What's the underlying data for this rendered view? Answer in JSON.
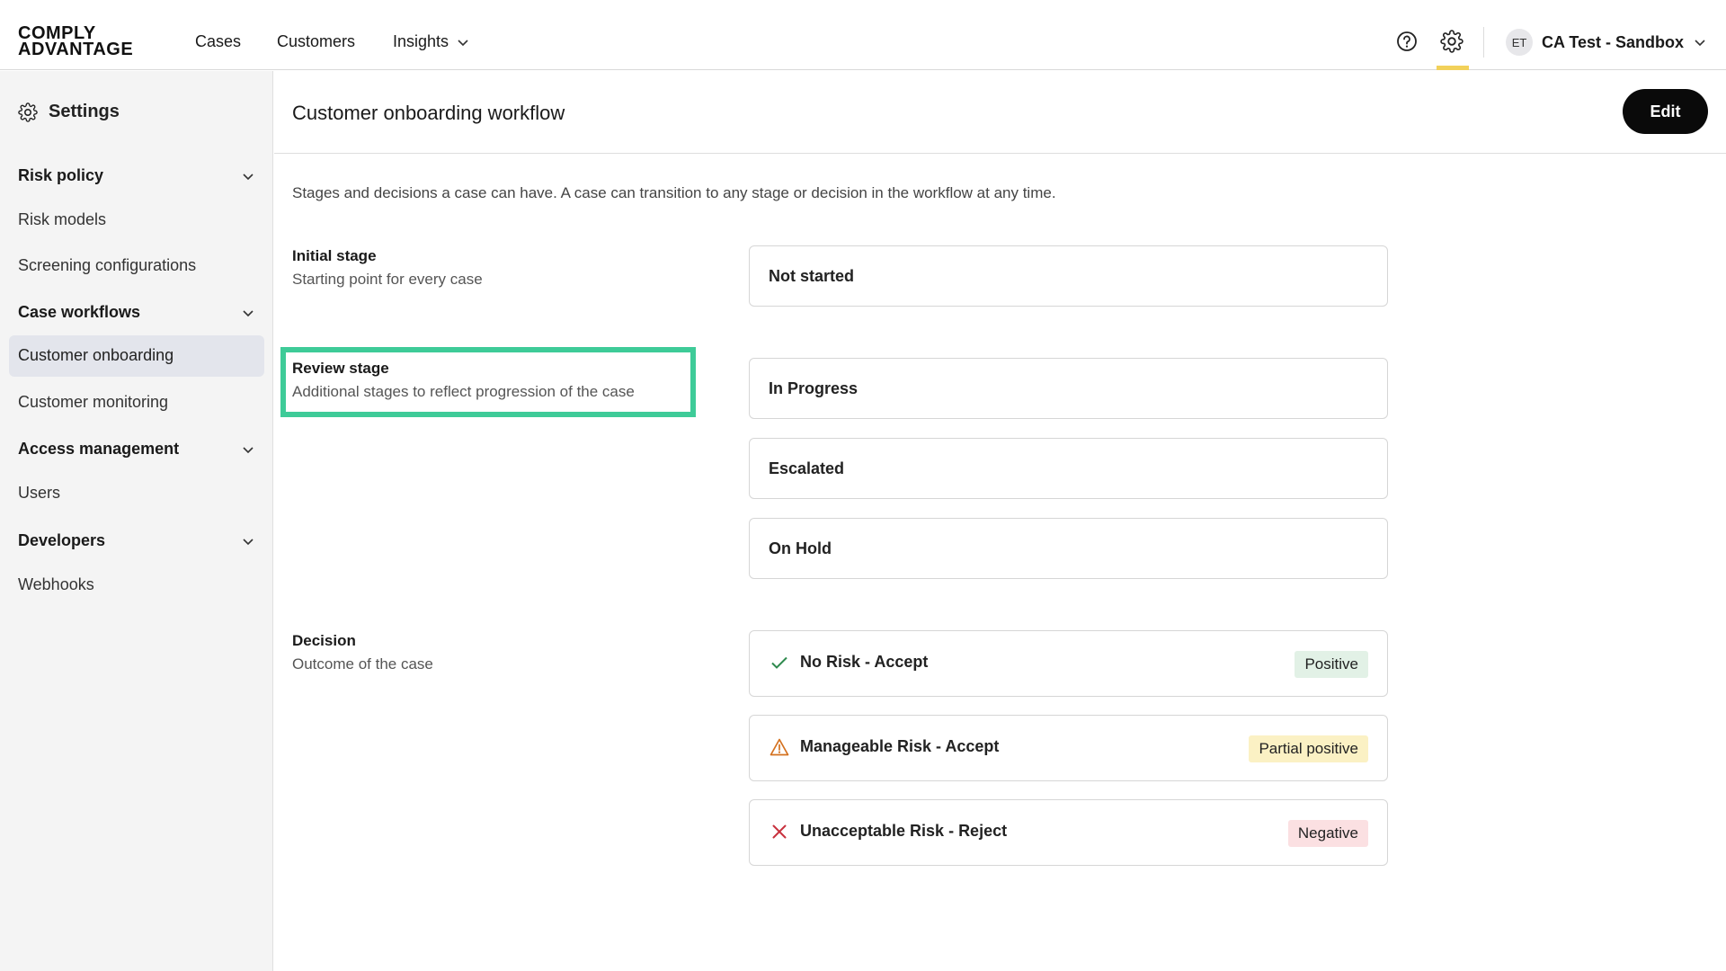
{
  "logo": {
    "line1": "COMPLY",
    "line2": "ADVANTAGE"
  },
  "nav": {
    "cases": "Cases",
    "customers": "Customers",
    "insights": "Insights",
    "help_icon": "help-circle-icon",
    "settings_icon": "gear-icon",
    "active_underline_color": "#f2d15a"
  },
  "account": {
    "initials": "ET",
    "name": "CA Test - Sandbox"
  },
  "sidebar": {
    "title": "Settings",
    "groups": [
      {
        "label": "Risk policy",
        "items": [
          "Risk models",
          "Screening configurations"
        ]
      },
      {
        "label": "Case workflows",
        "items": [
          "Customer onboarding",
          "Customer monitoring"
        ]
      },
      {
        "label": "Access management",
        "items": [
          "Users"
        ]
      },
      {
        "label": "Developers",
        "items": [
          "Webhooks"
        ]
      }
    ],
    "active_item": "Customer onboarding"
  },
  "main": {
    "title": "Customer onboarding workflow",
    "edit_label": "Edit",
    "intro": "Stages and decisions a case can have. A case can transition to any stage or decision in the workflow at any time.",
    "initial": {
      "title": "Initial stage",
      "subtitle": "Starting point for every case",
      "stage": "Not started"
    },
    "review": {
      "title": "Review stage",
      "subtitle": "Additional stages to reflect progression of the case",
      "stages": [
        "In Progress",
        "Escalated",
        "On Hold"
      ],
      "highlight_color": "#3ecb98"
    },
    "decision": {
      "title": "Decision",
      "subtitle": "Outcome of the case",
      "items": [
        {
          "label": "No Risk - Accept",
          "badge": "Positive",
          "icon": "check-icon",
          "badge_color": "#e2f1e6"
        },
        {
          "label": "Manageable Risk - Accept",
          "badge": "Partial positive",
          "icon": "warning-triangle-icon",
          "badge_color": "#fbf1c4"
        },
        {
          "label": "Unacceptable Risk - Reject",
          "badge": "Negative",
          "icon": "x-icon",
          "badge_color": "#fbe0e2"
        }
      ]
    }
  }
}
